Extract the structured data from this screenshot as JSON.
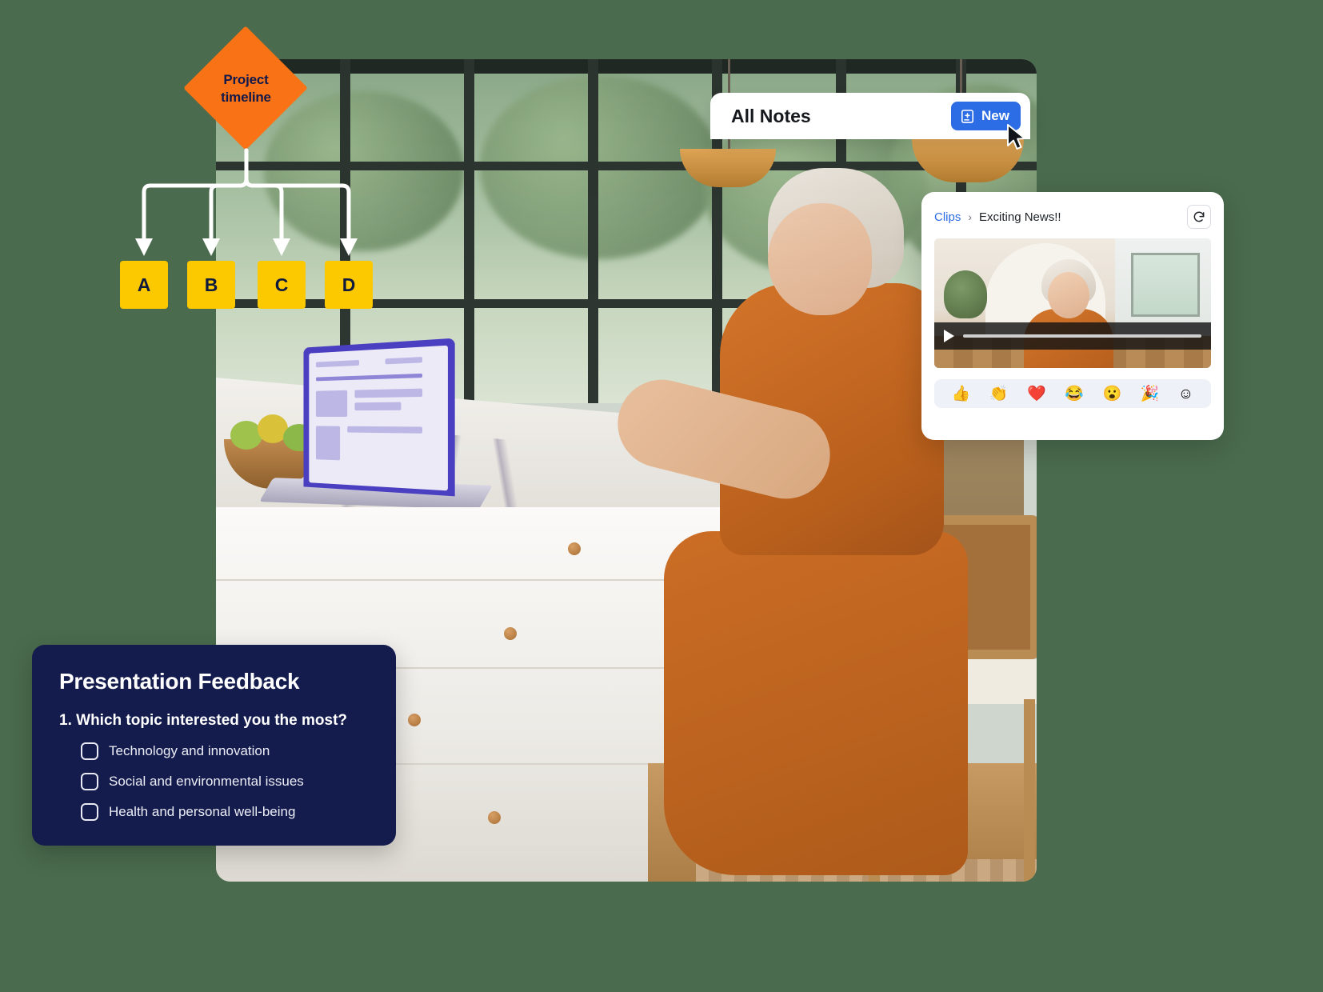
{
  "flow": {
    "diamond_label_line1": "Project",
    "diamond_label_line2": "timeline",
    "diamond_color": "#f97316",
    "node_color": "#fcc800",
    "nodes": [
      {
        "label": "A"
      },
      {
        "label": "B"
      },
      {
        "label": "C"
      },
      {
        "label": "D"
      }
    ]
  },
  "notes_panel": {
    "title": "All Notes",
    "new_button_label": "New",
    "new_button_icon": "note-plus-icon",
    "accent": "#2c6ce4",
    "cursor_icon": "mouse-pointer-icon"
  },
  "clips_panel": {
    "breadcrumb_root": "Clips",
    "breadcrumb_separator": "›",
    "breadcrumb_current": "Exciting News!!",
    "refresh_icon": "refresh-icon",
    "link_color": "#2c6ce4",
    "video": {
      "play_icon": "play-icon",
      "progress_percent": 0
    },
    "reactions": [
      {
        "name": "thumbs-up-emoji",
        "glyph": "👍"
      },
      {
        "name": "clapping-hands-emoji",
        "glyph": "👏"
      },
      {
        "name": "red-heart-emoji",
        "glyph": "❤️"
      },
      {
        "name": "laughing-emoji",
        "glyph": "😂"
      },
      {
        "name": "surprised-emoji",
        "glyph": "😮"
      },
      {
        "name": "party-popper-emoji",
        "glyph": "🎉"
      },
      {
        "name": "add-reaction-emoji",
        "glyph": "☺"
      }
    ]
  },
  "feedback_card": {
    "title": "Presentation Feedback",
    "question_number": "1.",
    "question": "Which topic interested you the most?",
    "background": "#141b4d",
    "options": [
      {
        "label": "Technology and innovation",
        "checked": false
      },
      {
        "label": "Social and environmental issues",
        "checked": false
      },
      {
        "label": "Health and personal well-being",
        "checked": false
      }
    ]
  }
}
